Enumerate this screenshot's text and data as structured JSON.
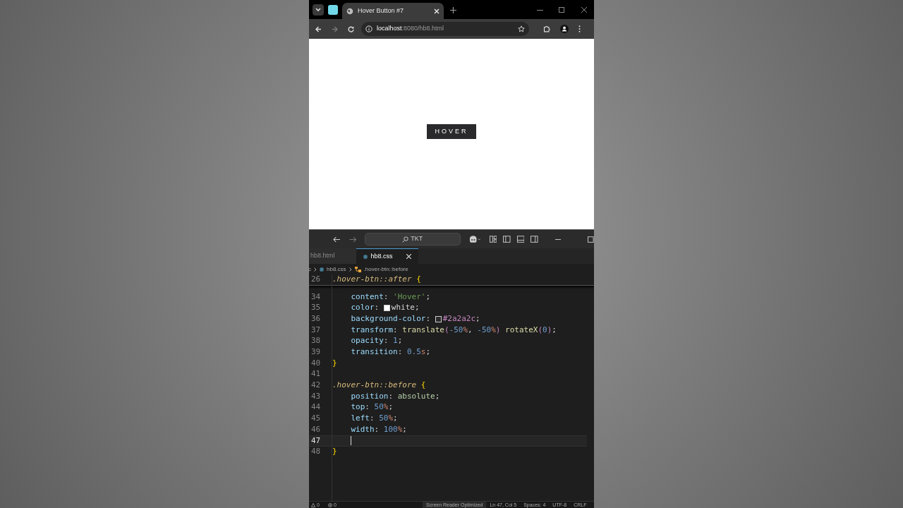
{
  "browser": {
    "tab_title": "Hover Button #7",
    "url_host": "localhost",
    "url_rest": ":8080/hb8.html"
  },
  "page": {
    "button_label": "HOVER"
  },
  "editor": {
    "search": "TKT",
    "tabs": [
      {
        "label": "hb8.html",
        "selected": false
      },
      {
        "label": "hb8.css",
        "selected": true
      }
    ],
    "breadcrumb": {
      "lead": "c",
      "file": "hb8.css",
      "symbol": ".hover-btn::before"
    },
    "sticky": {
      "number": "26",
      "tokens": [
        {
          "kind": "selector",
          "text": ".hover-btn::after"
        },
        {
          "kind": "brace",
          "text": " {"
        }
      ]
    },
    "lines": [
      {
        "number": "34",
        "current": false,
        "tokens": [
          {
            "kind": "prop",
            "text": "    content"
          },
          {
            "kind": "punct",
            "text": ": "
          },
          {
            "kind": "string",
            "text": "'Hover'"
          },
          {
            "kind": "punct",
            "text": ";"
          }
        ]
      },
      {
        "number": "35",
        "current": false,
        "tokens": [
          {
            "kind": "prop",
            "text": "    color"
          },
          {
            "kind": "punct",
            "text": ": "
          },
          {
            "kind": "swatch",
            "color": "#ffffff"
          },
          {
            "kind": "punct",
            "text": "white;"
          }
        ]
      },
      {
        "number": "36",
        "current": false,
        "tokens": [
          {
            "kind": "prop",
            "text": "    background-color"
          },
          {
            "kind": "punct",
            "text": ": "
          },
          {
            "kind": "swatch",
            "color": "#2a2a2c"
          },
          {
            "kind": "func",
            "text": "#2a2a2c"
          },
          {
            "kind": "punct",
            "text": ";"
          }
        ]
      },
      {
        "number": "37",
        "current": false,
        "tokens": [
          {
            "kind": "prop",
            "text": "    transform"
          },
          {
            "kind": "punct",
            "text": ": "
          },
          {
            "kind": "value",
            "text": "translate"
          },
          {
            "kind": "paren",
            "text": "("
          },
          {
            "kind": "number",
            "text": "-50"
          },
          {
            "kind": "unit",
            "text": "%"
          },
          {
            "kind": "punct",
            "text": ", "
          },
          {
            "kind": "number",
            "text": "-50"
          },
          {
            "kind": "unit",
            "text": "%"
          },
          {
            "kind": "paren",
            "text": ")"
          },
          {
            "kind": "value",
            "text": " rotateX"
          },
          {
            "kind": "paren",
            "text": "("
          },
          {
            "kind": "number",
            "text": "0"
          },
          {
            "kind": "paren",
            "text": ")"
          },
          {
            "kind": "punct",
            "text": ";"
          }
        ]
      },
      {
        "number": "38",
        "current": false,
        "tokens": [
          {
            "kind": "prop",
            "text": "    opacity"
          },
          {
            "kind": "punct",
            "text": ": "
          },
          {
            "kind": "number",
            "text": "1"
          },
          {
            "kind": "punct",
            "text": ";"
          }
        ]
      },
      {
        "number": "39",
        "current": false,
        "tokens": [
          {
            "kind": "prop",
            "text": "    transition"
          },
          {
            "kind": "punct",
            "text": ": "
          },
          {
            "kind": "number",
            "text": "0.5"
          },
          {
            "kind": "unit",
            "text": "s"
          },
          {
            "kind": "punct",
            "text": ";"
          }
        ]
      },
      {
        "number": "40",
        "current": false,
        "tokens": [
          {
            "kind": "brace",
            "text": "}"
          }
        ]
      },
      {
        "number": "41",
        "current": false
      },
      {
        "number": "42",
        "current": false,
        "tokens": [
          {
            "kind": "selector",
            "text": ".hover-btn::before"
          },
          {
            "kind": "brace",
            "text": " {"
          }
        ]
      },
      {
        "number": "43",
        "current": false,
        "tokens": [
          {
            "kind": "prop",
            "text": "    position"
          },
          {
            "kind": "punct",
            "text": ": "
          },
          {
            "kind": "keyword",
            "text": "absolute"
          },
          {
            "kind": "punct",
            "text": ";"
          }
        ]
      },
      {
        "number": "44",
        "current": false,
        "tokens": [
          {
            "kind": "prop",
            "text": "    top"
          },
          {
            "kind": "punct",
            "text": ": "
          },
          {
            "kind": "number",
            "text": "50"
          },
          {
            "kind": "unit",
            "text": "%"
          },
          {
            "kind": "punct",
            "text": ";"
          }
        ]
      },
      {
        "number": "45",
        "current": false,
        "tokens": [
          {
            "kind": "prop",
            "text": "    left"
          },
          {
            "kind": "punct",
            "text": ": "
          },
          {
            "kind": "number",
            "text": "50"
          },
          {
            "kind": "unit",
            "text": "%"
          },
          {
            "kind": "punct",
            "text": ";"
          }
        ]
      },
      {
        "number": "46",
        "current": false,
        "tokens": [
          {
            "kind": "prop",
            "text": "    width"
          },
          {
            "kind": "punct",
            "text": ": "
          },
          {
            "kind": "number",
            "text": "100"
          },
          {
            "kind": "unit",
            "text": "%"
          },
          {
            "kind": "punct",
            "text": ";"
          }
        ]
      },
      {
        "number": "47",
        "current": true
      },
      {
        "number": "48",
        "current": false,
        "tokens": [
          {
            "kind": "brace",
            "text": "}"
          }
        ]
      }
    ],
    "status": {
      "warnings": "0",
      "errors": "0",
      "items": [
        "Screen Reader Optimized",
        "Ln 47, Col 5",
        "Spaces: 4",
        "UTF-8",
        "CRLF"
      ]
    }
  }
}
